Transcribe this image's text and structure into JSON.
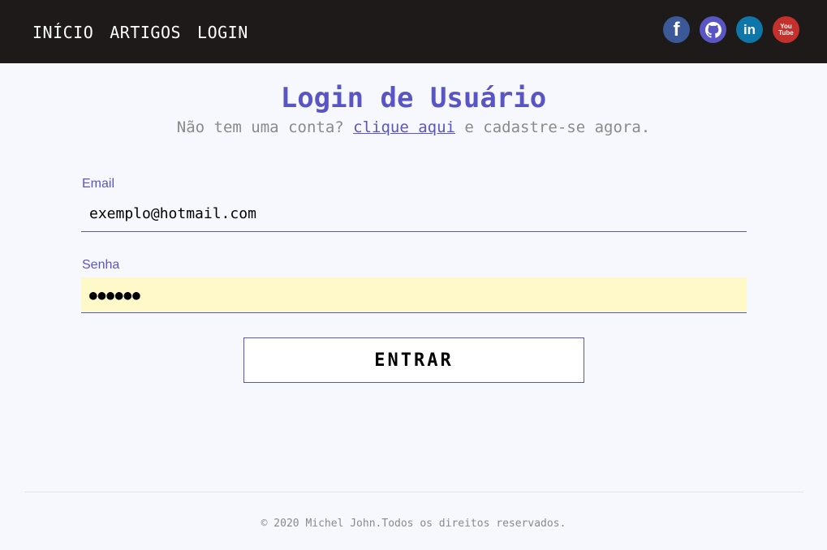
{
  "nav": {
    "items": [
      {
        "label": "INÍCIO"
      },
      {
        "label": "ARTIGOS"
      },
      {
        "label": "LOGIN"
      }
    ]
  },
  "social": {
    "facebook": {
      "icon": "facebook-icon",
      "glyph": "f"
    },
    "github": {
      "icon": "github-icon"
    },
    "linkedin": {
      "icon": "linkedin-icon",
      "glyph": "in"
    },
    "youtube": {
      "icon": "youtube-icon",
      "glyph_top": "You",
      "glyph_bottom": "Tube"
    }
  },
  "main": {
    "title": "Login de Usuário",
    "subtitle_prefix": "Não tem uma conta? ",
    "subtitle_link": "clique aqui",
    "subtitle_suffix": " e cadastre-se agora."
  },
  "form": {
    "email_label": "Email",
    "email_value": "exemplo@hotmail.com",
    "password_label": "Senha",
    "password_value": "●●●●●●",
    "submit_label": "ENTRAR"
  },
  "footer": {
    "text": "© 2020 Michel John.Todos os direitos reservados."
  },
  "colors": {
    "accent": "#5a55c4",
    "topbar": "#1e1a1a",
    "autofill": "#fff8c8"
  }
}
